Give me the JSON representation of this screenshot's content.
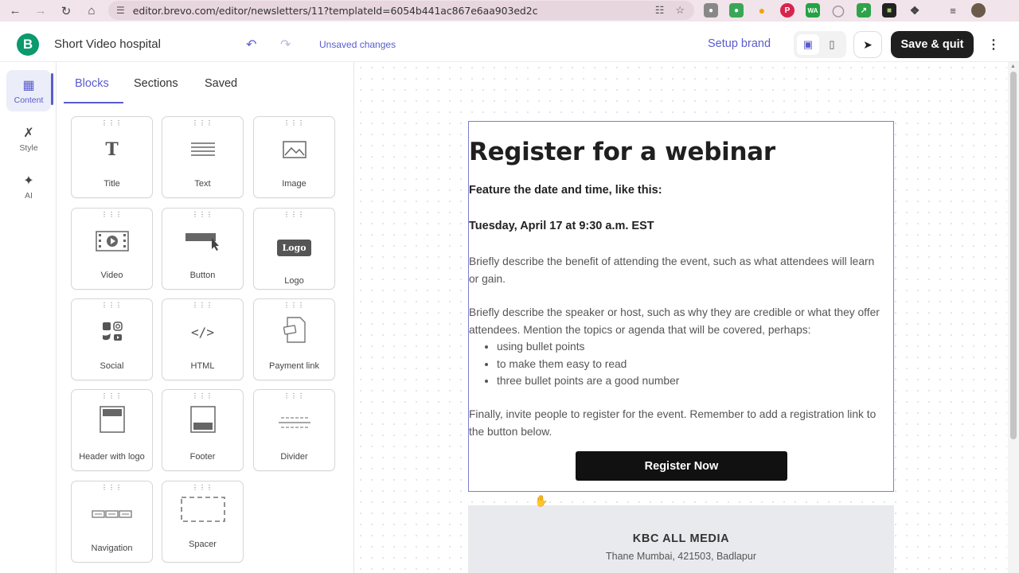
{
  "browser": {
    "url": "editor.brevo.com/editor/newsletters/11?templateId=6054b441ac867e6aa903ed2c"
  },
  "header": {
    "logo_letter": "B",
    "doc_title": "Short Video hospital",
    "unsaved": "Unsaved changes",
    "setup_brand": "Setup brand",
    "save_quit": "Save & quit"
  },
  "rail": {
    "items": [
      {
        "label": "Content"
      },
      {
        "label": "Style"
      },
      {
        "label": "AI"
      }
    ]
  },
  "panel": {
    "tabs": [
      "Blocks",
      "Sections",
      "Saved"
    ],
    "blocks": [
      {
        "label": "Title",
        "icon": "title-icon"
      },
      {
        "label": "Text",
        "icon": "text-icon"
      },
      {
        "label": "Image",
        "icon": "image-icon"
      },
      {
        "label": "Video",
        "icon": "video-icon"
      },
      {
        "label": "Button",
        "icon": "button-icon"
      },
      {
        "label": "Logo",
        "icon": "logo-icon",
        "icon_text": "Logo"
      },
      {
        "label": "Social",
        "icon": "social-icon"
      },
      {
        "label": "HTML",
        "icon": "code-icon"
      },
      {
        "label": "Payment link",
        "icon": "payment-icon"
      },
      {
        "label": "Header with logo",
        "icon": "header-icon"
      },
      {
        "label": "Footer",
        "icon": "footer-icon"
      },
      {
        "label": "Divider",
        "icon": "divider-icon"
      },
      {
        "label": "Navigation",
        "icon": "navigation-icon"
      },
      {
        "label": "Spacer",
        "icon": "spacer-icon"
      }
    ]
  },
  "email": {
    "title": "Register for a webinar",
    "subhead": "Feature the date and time, like this:",
    "date": "Tuesday, April 17 at 9:30 a.m. EST",
    "para1_line1": "Briefly describe the benefit of attending the event, such as what attendees will learn",
    "para1_line2": "or gain.",
    "para2_line1": "Briefly describe the speaker or host, such as why they are credible or what they offer",
    "para2_line2": "attendees. Mention the topics or agenda that will be covered, perhaps:",
    "bullets": [
      "using bullet points",
      "to make them easy to read",
      "three bullet points are a good number"
    ],
    "para3_line1": "Finally, invite people to register for the event. Remember to add a registration link to",
    "para3_line2": "the button below.",
    "cta": "Register Now"
  },
  "footer": {
    "name": "KBC ALL MEDIA",
    "address": "Thane Mumbai, 421503, Badlapur"
  },
  "colors": {
    "accent": "#5a5ccc",
    "brand": "#0b996e",
    "dark": "#1f1f1f"
  }
}
